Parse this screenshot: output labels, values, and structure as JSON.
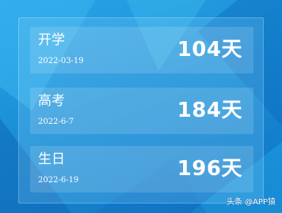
{
  "colors": {
    "background_light": "#2aa6e8",
    "background_dark": "#0f74c4",
    "text": "#ffffff"
  },
  "events": [
    {
      "title": "开学",
      "date": "2022-03-19",
      "days": "104天"
    },
    {
      "title": "高考",
      "date": "2022-6-7",
      "days": "184天"
    },
    {
      "title": "生日",
      "date": "2022-6-19",
      "days": "196天"
    }
  ],
  "watermark": "头条 @APP猿"
}
